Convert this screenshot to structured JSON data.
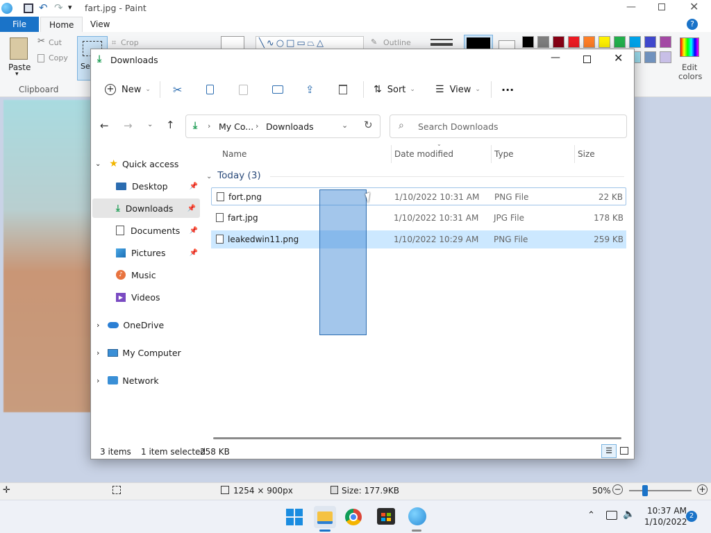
{
  "paint": {
    "title": "fart.jpg - Paint",
    "tabs": {
      "file": "File",
      "home": "Home",
      "view": "View"
    },
    "clipboard": {
      "paste": "Paste",
      "cut": "Cut",
      "copy": "Copy",
      "group": "Clipboard"
    },
    "image": {
      "crop": "Crop",
      "select_short": "Sel"
    },
    "shapes": {
      "outline": "Outline"
    },
    "colors": {
      "edit_colors_line1": "Edit",
      "edit_colors_line2": "colors"
    },
    "palette": [
      "#000000",
      "#7f7f7f",
      "#880015",
      "#ed1c24",
      "#ff7f27",
      "#fff200",
      "#22b14c",
      "#00a2e8",
      "#3f48cc",
      "#a349a4",
      "#ffffff",
      "#c3c3c3",
      "#b97a57",
      "#ffaec9",
      "#ffc90e",
      "#efe4b0",
      "#b5e61d",
      "#99d9ea",
      "#7092be",
      "#c8bfe7"
    ],
    "status": {
      "dimensions": "1254 × 900px",
      "size": "Size: 177.9KB",
      "zoom": "50%"
    }
  },
  "explorer": {
    "title": "Downloads",
    "toolbar": {
      "new": "New",
      "sort": "Sort",
      "view": "View",
      "more": "···"
    },
    "breadcrumb": {
      "root": "My Co...",
      "current": "Downloads"
    },
    "search_placeholder": "Search Downloads",
    "columns": {
      "name": "Name",
      "date": "Date modified",
      "type": "Type",
      "size": "Size"
    },
    "group_label": "Today (3)",
    "files": [
      {
        "name": "fort.png",
        "date": "1/10/2022 10:31 AM",
        "type": "PNG File",
        "size": "22 KB"
      },
      {
        "name": "fart.jpg",
        "date": "1/10/2022 10:31 AM",
        "type": "JPG File",
        "size": "178 KB"
      },
      {
        "name": "leakedwin11.png",
        "date": "1/10/2022 10:29 AM",
        "type": "PNG File",
        "size": "259 KB"
      }
    ],
    "nav": {
      "quick_access": "Quick access",
      "desktop": "Desktop",
      "downloads": "Downloads",
      "documents": "Documents",
      "pictures": "Pictures",
      "music": "Music",
      "videos": "Videos",
      "onedrive": "OneDrive",
      "my_computer": "My Computer",
      "network": "Network"
    },
    "status": {
      "items": "3 items",
      "selected": "1 item selected",
      "size": "258 KB"
    }
  },
  "taskbar": {
    "time": "10:37 AM",
    "date": "1/10/2022",
    "notifications": "2"
  }
}
